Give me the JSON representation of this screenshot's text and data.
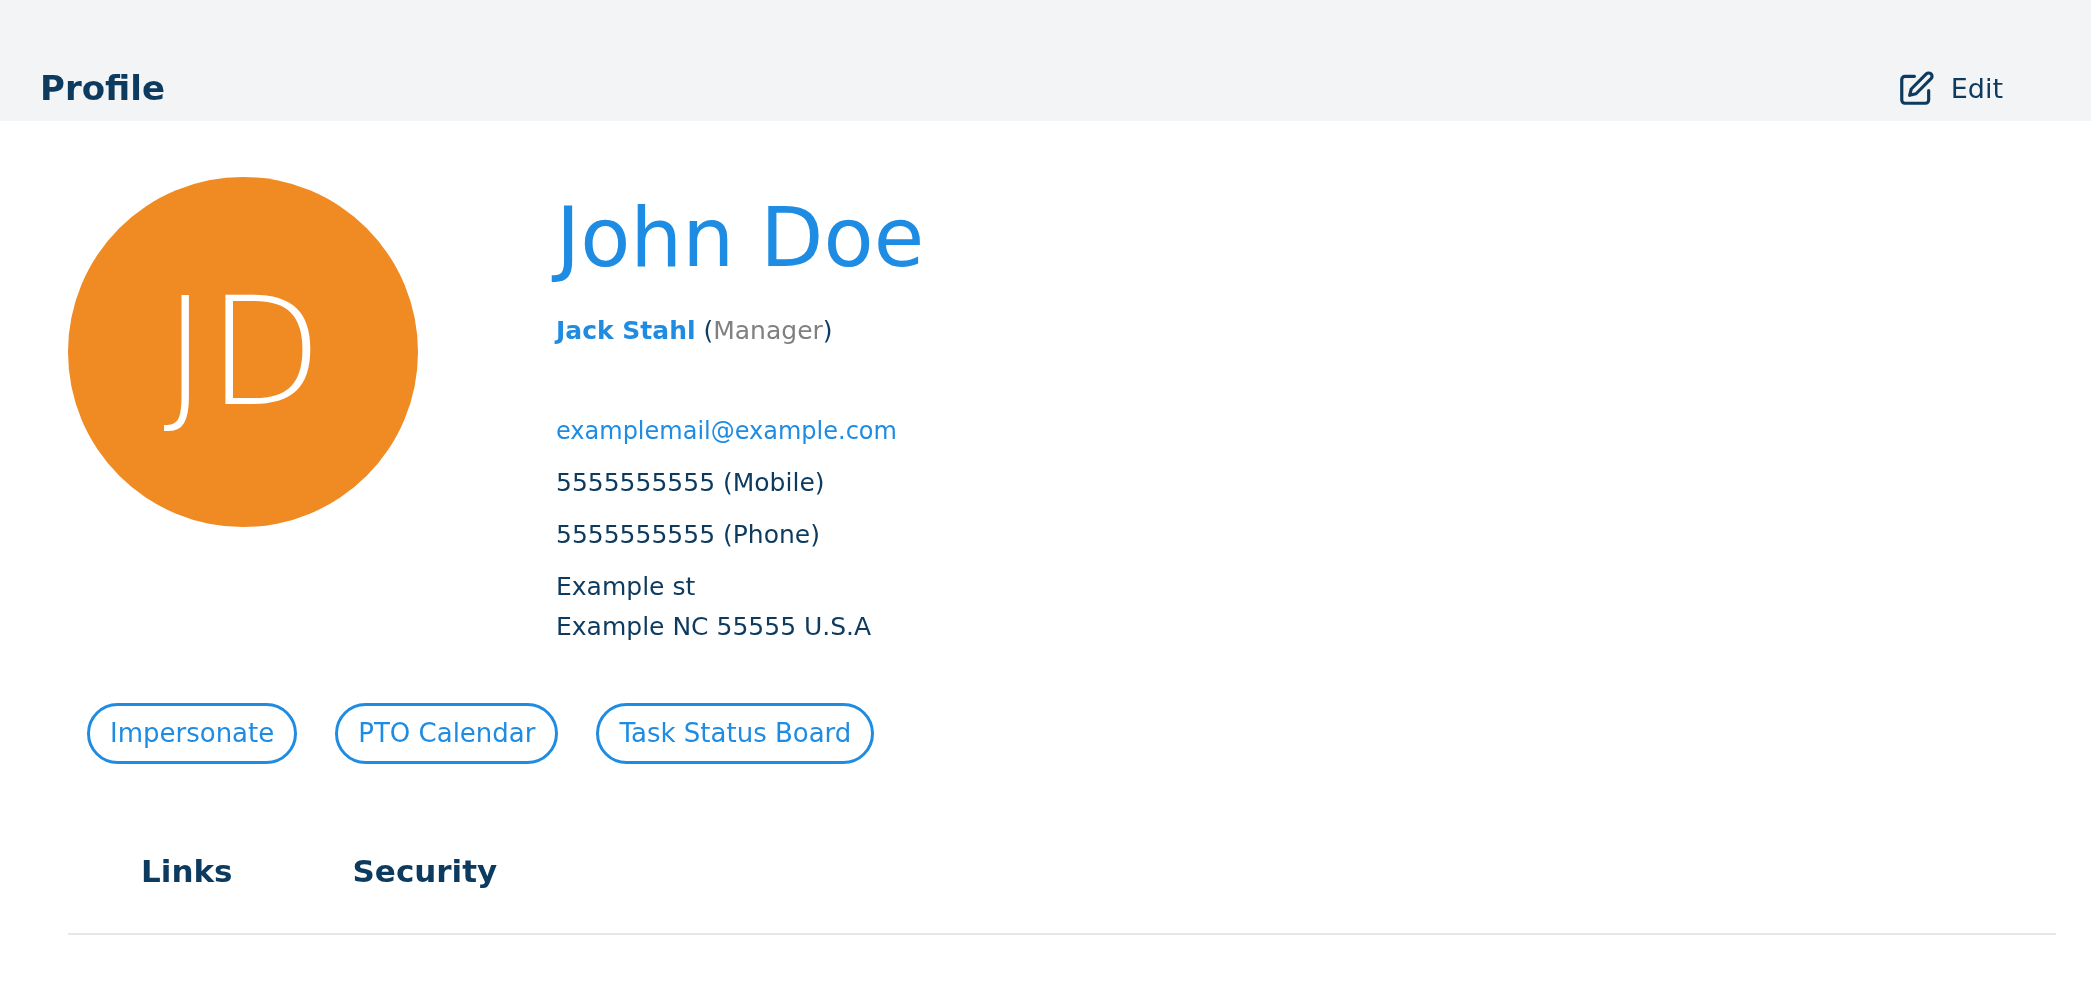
{
  "header": {
    "title": "Profile",
    "edit_label": "Edit"
  },
  "profile": {
    "initials": "JD",
    "name": "John Doe",
    "manager_name": "Jack Stahl",
    "open_paren": "(",
    "manager_role": "Manager",
    "close_paren": ")",
    "email": "examplemail@example.com",
    "mobile": "5555555555 (Mobile)",
    "phone": "5555555555 (Phone)",
    "address_lines": [
      "Example st",
      "Example NC 55555 U.S.A"
    ]
  },
  "actions": [
    "Impersonate",
    "PTO Calendar",
    "Task Status Board"
  ],
  "tabs": [
    {
      "label": "Links",
      "selected": false
    },
    {
      "label": "Security",
      "selected": false
    }
  ]
}
